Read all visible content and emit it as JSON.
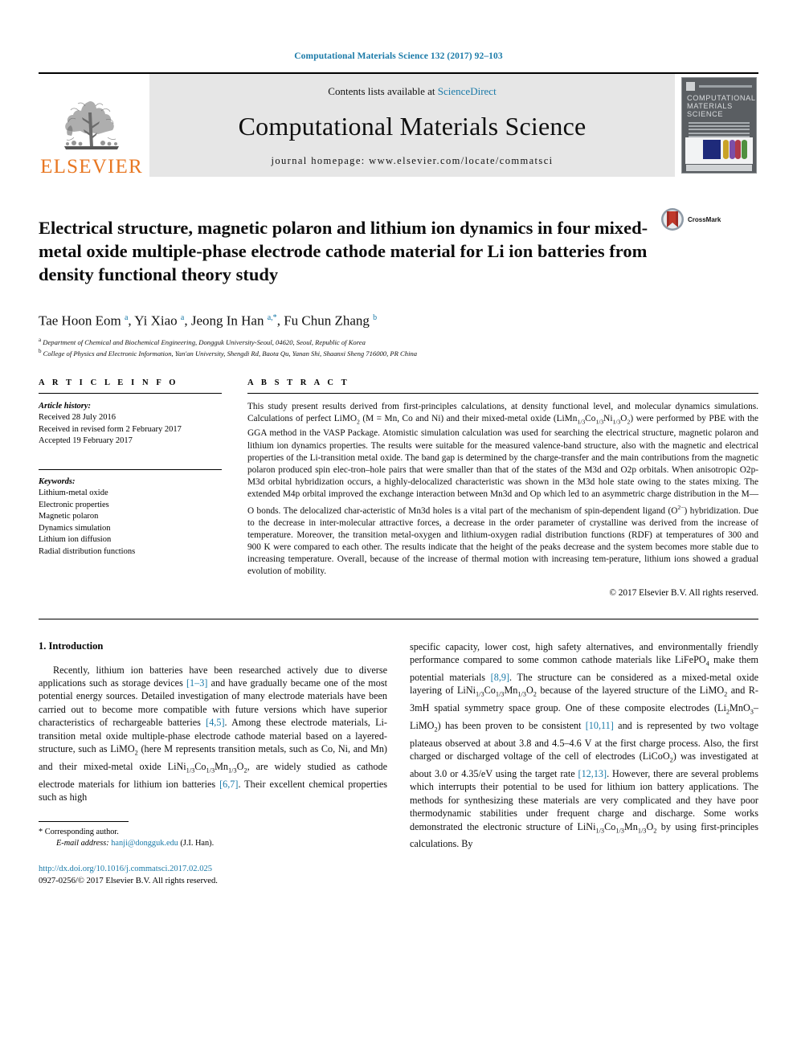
{
  "running_head": "Computational Materials Science 132 (2017) 92–103",
  "masthead": {
    "publisher_name": "ELSEVIER",
    "contents_prefix": "Contents lists available at ",
    "contents_link": "ScienceDirect",
    "journal_title": "Computational Materials Science",
    "homepage_line": "journal homepage: www.elsevier.com/locate/commatsci",
    "cover_title_line1": "COMPUTATIONAL",
    "cover_title_line2": "MATERIALS",
    "cover_title_line3": "SCIENCE"
  },
  "article": {
    "title": "Electrical structure, magnetic polaron and lithium ion dynamics in four mixed-metal oxide multiple-phase electrode cathode material for Li ion batteries from density functional theory study",
    "crossmark_label": "CrossMark",
    "authors_html": "Tae Hoon Eom <sup>a</sup>, Yi Xiao <sup>a</sup>, Jeong In Han <sup>a,*</sup>, Fu Chun Zhang <sup>b</sup>",
    "affiliation_a": "Department of Chemical and Biochemical Engineering, Dongguk University-Seoul, 04620, Seoul, Republic of Korea",
    "affiliation_b": "College of Physics and Electronic Information, Yan'an University, Shengdi Rd, Baota Qu, Yanan Shi, Shaanxi Sheng 716000, PR China"
  },
  "article_info": {
    "kicker": "A R T I C L E   I N F O",
    "history_label": "Article history:",
    "history": [
      "Received 28 July 2016",
      "Received in revised form 2 February 2017",
      "Accepted 19 February 2017"
    ],
    "keywords_label": "Keywords:",
    "keywords": [
      "Lithium-metal oxide",
      "Electronic properties",
      "Magnetic polaron",
      "Dynamics simulation",
      "Lithium ion diffusion",
      "Radial distribution functions"
    ]
  },
  "abstract": {
    "kicker": "A B S T R A C T",
    "text_html": "This study present results derived from first-principles calculations, at density functional level, and molecular dynamics simulations. Calculations of perfect LiMO<sub>2</sub> (M&nbsp;=&nbsp;Mn, Co and Ni) and their mixed-metal oxide (LiMn<sub>1/3</sub>Co<sub>1/3</sub>Ni<sub>1/3</sub>O<sub>2</sub>) were performed by PBE with the GGA method in the VASP Package. Atomistic simulation calculation was used for searching the electrical structure, magnetic polaron and lithium ion dynamics properties. The results were suitable for the measured valence-band structure, also with the magnetic and electrical properties of the Li-transition metal oxide. The band gap is determined by the charge-transfer and the main contributions from the magnetic polaron produced spin elec-tron–hole pairs that were smaller than that of the states of the M3d and O2p orbitals. When anisotropic O2p-M3d orbital hybridization occurs, a highly-delocalized characteristic was shown in the M3d hole state owing to the states mixing. The extended M4p orbital improved the exchange interaction between Mn3d and Op which led to an asymmetric charge distribution in the M—O bonds. The delocalized char-acteristic of Mn3d holes is a vital part of the mechanism of spin-dependent ligand (O<sup class=\"mini\">2−</sup>) hybridization. Due to the decrease in inter-molecular attractive forces, a decrease in the order parameter of crystalline was derived from the increase of temperature. Moreover, the transition metal-oxygen and lithium-oxygen radial distribution functions (RDF) at temperatures of 300 and 900&nbsp;K were compared to each other. The results indicate that the height of the peaks decrease and the system becomes more stable due to increasing temperature. Overall, because of the increase of thermal motion with increasing tem-perature, lithium ions showed a gradual evolution of mobility.",
    "copyright": "© 2017 Elsevier B.V. All rights reserved."
  },
  "body": {
    "section_heading": "1. Introduction",
    "left_paragraph_html": "Recently, lithium ion batteries have been researched actively due to diverse applications such as storage devices <span class=\"ref\">[1–3]</span> and have gradually became one of the most potential energy sources. Detailed investigation of many electrode materials have been carried out to become more compatible with future versions which have superior characteristics of rechargeable batteries <span class=\"ref\">[4,5]</span>. Among these electrode materials, Li-transition metal oxide multiple-phase electrode cathode material based on a layered-structure, such as LiMO<sub>2</sub> (here M represents transition metals, such as Co, Ni, and Mn) and their mixed-metal oxide LiNi<sub>1/3</sub>Co<sub>1/3</sub>Mn<sub>1/3</sub>O<sub>2</sub>, are widely studied as cathode electrode materials for lithium ion batteries <span class=\"ref\">[6,7]</span>. Their excellent chemical properties such as high",
    "right_paragraph_html": "specific capacity, lower cost, high safety alternatives, and environmentally friendly performance compared to some common cathode materials like LiFePO<sub>4</sub> make them potential materials <span class=\"ref\">[8,9]</span>. The structure can be considered as a mixed-metal oxide layering of LiNi<sub>1/3</sub>Co<sub>1/3</sub>Mn<sub>1/3</sub>O<sub>2</sub> because of the layered structure of the LiMO<sub>2</sub> and R-3mH spatial symmetry space group. One of these composite electrodes (Li<sub>2</sub>MnO<sub>3</sub>–LiMO<sub>2</sub>) has been proven to be consistent <span class=\"ref\">[10,11]</span> and is represented by two voltage plateaus observed at about 3.8 and 4.5–4.6 V at the first charge process. Also, the first charged or discharged voltage of the cell of electrodes (LiCoO<sub>2</sub>) was investigated at about 3.0 or 4.35/eV using the target rate <span class=\"ref\">[12,13]</span>. However, there are several problems which interrupts their potential to be used for lithium ion battery applications. The methods for synthesizing these materials are very complicated and they have poor thermodynamic stabilities under frequent charge and discharge. Some works demonstrated the electronic structure of LiNi<sub>1/3</sub>Co<sub>1/3</sub>Mn<sub>1/3</sub>O<sub>2</sub> by using first-principles calculations. By"
  },
  "footer": {
    "corresponding_marker": "*",
    "corresponding_label": "Corresponding author.",
    "email_label": "E-mail address:",
    "email": "hanji@dongguk.edu",
    "email_suffix": "(J.I. Han).",
    "doi_url": "http://dx.doi.org/10.1016/j.commatsci.2017.02.025",
    "issn_line": "0927-0256/© 2017 Elsevier B.V. All rights reserved."
  },
  "colors": {
    "link": "#1a7aa8",
    "elsevier_orange": "#e87722",
    "band_gray": "#e6e6e6"
  }
}
